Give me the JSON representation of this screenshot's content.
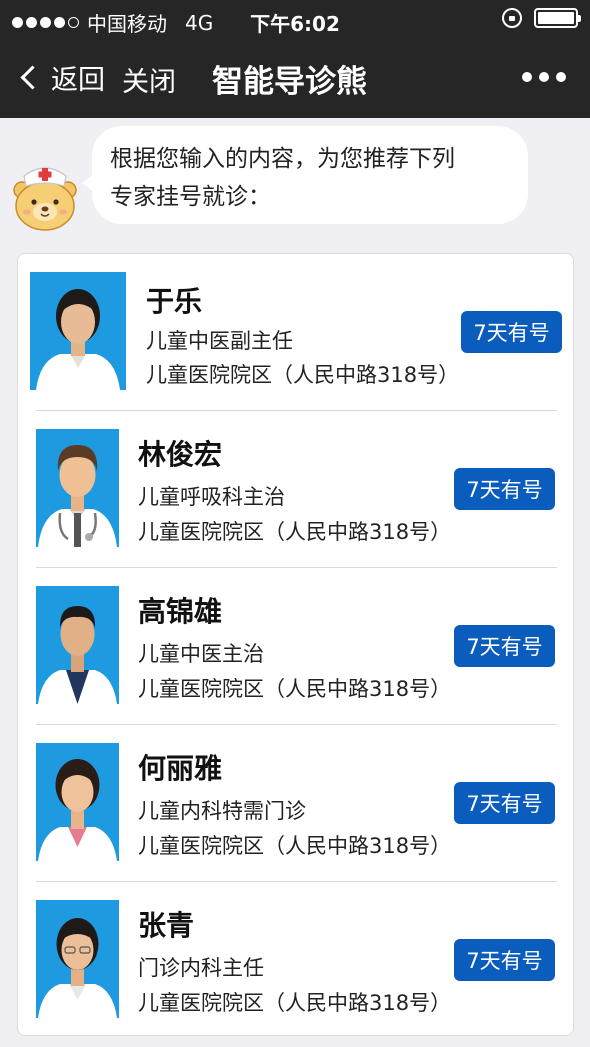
{
  "status": {
    "carrier": "中国移动",
    "network": "4G",
    "time": "下午6:02"
  },
  "nav": {
    "back_label": "返回",
    "close_label": "关闭",
    "title": "智能导诊熊"
  },
  "message": {
    "line1": "根据您输入的内容，为您推荐下列",
    "line2": "专家挂号就诊："
  },
  "doctors": [
    {
      "name": "于乐",
      "title": "儿童中医副主任",
      "hospital": "儿童医院院区（人民中路318号）",
      "availability": "7天有号"
    },
    {
      "name": "林俊宏",
      "title": "儿童呼吸科主治",
      "hospital": "儿童医院院区（人民中路318号）",
      "availability": "7天有号"
    },
    {
      "name": "高锦雄",
      "title": "儿童中医主治",
      "hospital": "儿童医院院区（人民中路318号）",
      "availability": "7天有号"
    },
    {
      "name": "何丽雅",
      "title": "儿童内科特需门诊",
      "hospital": "儿童医院院区（人民中路318号）",
      "availability": "7天有号"
    },
    {
      "name": "张青",
      "title": "门诊内科主任",
      "hospital": "儿童医院院区（人民中路318号）",
      "availability": "7天有号"
    }
  ],
  "colors": {
    "badge": "#0a5cbd",
    "navbar": "#262626",
    "page_bg": "#efeff4",
    "photo_bg": "#1e9be0"
  }
}
